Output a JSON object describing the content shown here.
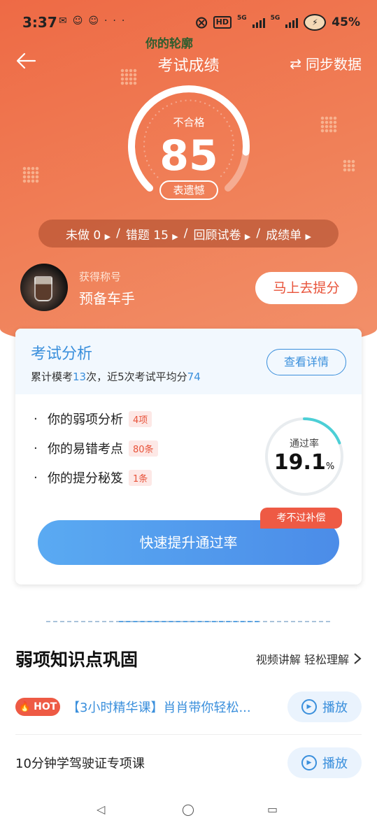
{
  "status_bar": {
    "time": "3:37",
    "notif_icons": [
      "app-icon",
      "app-icon",
      "app-icon"
    ],
    "more": "···",
    "hd": "HD",
    "net1": "5G",
    "net2": "5G",
    "battery_pct": "45%"
  },
  "overlay_text": "你的轮廓",
  "nav": {
    "title": "考试成绩",
    "sync_label": "同步数据"
  },
  "score": {
    "status": "不合格",
    "value": "85",
    "pill": "表遗憾",
    "gauge_fraction": 0.85
  },
  "links": [
    {
      "label": "未做 0"
    },
    {
      "label": "错题  15"
    },
    {
      "label": "回顾试卷"
    },
    {
      "label": "成绩单"
    }
  ],
  "profile": {
    "title_label": "获得称号",
    "title": "预备车手",
    "improve_button": "马上去提分"
  },
  "analysis": {
    "title": "考试分析",
    "summary_prefix": "累计模考",
    "mock_count": "13",
    "summary_mid": "次，近5次考试平均分",
    "average": "74",
    "detail_button": "查看详情",
    "items": [
      {
        "label": "你的弱项分析",
        "tag": "4项"
      },
      {
        "label": "你的易错考点",
        "tag": "80条"
      },
      {
        "label": "你的提分秘笈",
        "tag": "1条"
      }
    ],
    "pass_rate_label": "通过率",
    "pass_rate_value": "19.1",
    "pass_rate_unit": "%",
    "pass_rate_fraction": 0.191,
    "cta_badge": "考不过补偿",
    "cta_button": "快速提升通过率"
  },
  "weak_section": {
    "title": "弱项知识点巩固",
    "more_label": "视频讲解 轻松理解",
    "courses": [
      {
        "hot": "HOT",
        "title": "【3小时精华课】肖肖带你轻松...",
        "play": "播放"
      },
      {
        "title": "10分钟学驾驶证专项课",
        "play": "播放"
      }
    ]
  },
  "colors": {
    "hero": "#ee6a45",
    "accent_blue": "#3a8fdc",
    "accent_red": "#ee5a44"
  }
}
